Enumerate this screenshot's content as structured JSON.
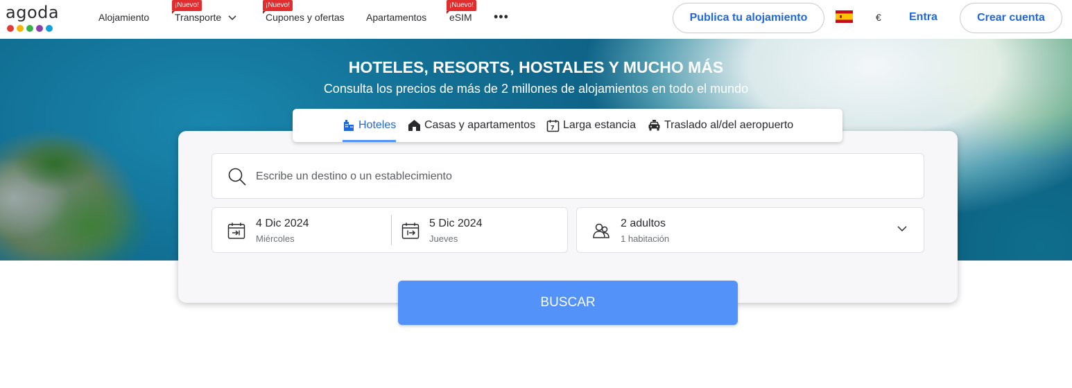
{
  "brand": {
    "name": "agoda",
    "dot_colors": [
      "#e03b3b",
      "#f5b40a",
      "#3ab14a",
      "#8b3fa8",
      "#13a0d9"
    ]
  },
  "nav": {
    "items": [
      {
        "label": "Alojamiento",
        "badge": ""
      },
      {
        "label": "Transporte",
        "badge": "¡Nuevo!"
      },
      {
        "label": "Cupones y ofertas",
        "badge": "¡Nuevo!"
      },
      {
        "label": "Apartamentos",
        "badge": ""
      },
      {
        "label": "eSIM",
        "badge": "¡Nuevo!"
      }
    ],
    "more_label": "•••",
    "list_property": "Publica tu alojamiento",
    "language_flag": "spain-flag-icon",
    "currency": "€",
    "sign_in": "Entra",
    "create_account": "Crear cuenta"
  },
  "hero": {
    "title": "HOTELES, RESORTS, HOSTALES Y MUCHO MÁS",
    "subtitle": "Consulta los precios de más de 2 millones de alojamientos en todo el mundo"
  },
  "search": {
    "tabs": [
      {
        "label": "Hoteles",
        "icon": "hotel-icon",
        "active": true
      },
      {
        "label": "Casas y apartamentos",
        "icon": "house-icon",
        "active": false
      },
      {
        "label": "Larga estancia",
        "icon": "calendar-7-icon",
        "active": false
      },
      {
        "label": "Traslado al/del aeropuerto",
        "icon": "car-icon",
        "active": false
      }
    ],
    "destination_placeholder": "Escribe un destino o un establecimiento",
    "check_in": {
      "date": "4 Dic 2024",
      "weekday": "Miércoles"
    },
    "check_out": {
      "date": "5 Dic 2024",
      "weekday": "Jueves"
    },
    "guests": {
      "adults": "2 adultos",
      "rooms": "1 habitación"
    },
    "button": "BUSCAR"
  },
  "colors": {
    "accent": "#2067da",
    "button": "#5392f9",
    "badge": "#e12d2d"
  }
}
